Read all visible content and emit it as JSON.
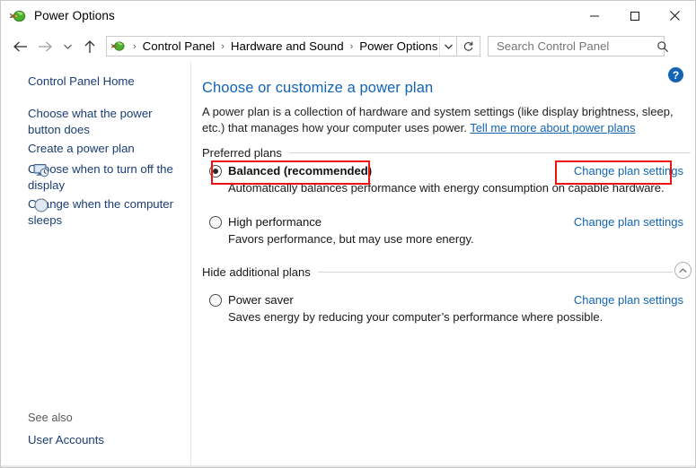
{
  "window": {
    "title": "Power Options",
    "app_icon": "power-plug-icon",
    "controls": {
      "minimize": "minimize-button",
      "maximize": "maximize-button",
      "close": "close-button"
    }
  },
  "navbar": {
    "back": "back-arrow",
    "forward": "forward-arrow",
    "recent": "recent-locations-chevron",
    "up": "up-arrow",
    "breadcrumb": [
      "Control Panel",
      "Hardware and Sound",
      "Power Options"
    ],
    "breadcrumb_separator": "›",
    "dropdown": "breadcrumb-dropdown-chevron",
    "refresh": "refresh-icon",
    "search": {
      "placeholder": "Search Control Panel",
      "value": "",
      "icon": "search-icon"
    }
  },
  "sidebar": {
    "home_label": "Control Panel Home",
    "items": [
      {
        "label": "Choose what the power button does",
        "icon": null
      },
      {
        "label": "Create a power plan",
        "icon": null
      },
      {
        "label": "Choose when to turn off the display",
        "icon": "monitor-clock-icon"
      },
      {
        "label": "Change when the computer sleeps",
        "icon": "moon-sleep-icon"
      }
    ],
    "see_also_label": "See also",
    "see_also_link": "User Accounts"
  },
  "main": {
    "heading": "Choose or customize a power plan",
    "description_part1": "A power plan is a collection of hardware and system settings (like display brightness, sleep, etc.) that manages how your computer uses power. ",
    "description_link": "Tell me more about power plans",
    "help_button": "?",
    "preferred_plans_label": "Preferred plans",
    "hide_additional_label": "Hide additional plans",
    "collapse_icon": "chevron-up-icon",
    "change_link_label": "Change plan settings",
    "plans": [
      {
        "name": "Balanced (recommended)",
        "description": "Automatically balances performance with energy consumption on capable hardware.",
        "selected": true,
        "highlighted": true,
        "group": "preferred"
      },
      {
        "name": "High performance",
        "description": "Favors performance, but may use more energy.",
        "selected": false,
        "highlighted": false,
        "group": "preferred"
      },
      {
        "name": "Power saver",
        "description": "Saves energy by reducing your computer’s performance where possible.",
        "selected": false,
        "highlighted": false,
        "group": "additional"
      }
    ]
  },
  "colors": {
    "link_blue": "#1364b5",
    "sidebar_link": "#1a3d73",
    "annotation_red": "#ee1111",
    "heading_blue": "#1364b5"
  }
}
